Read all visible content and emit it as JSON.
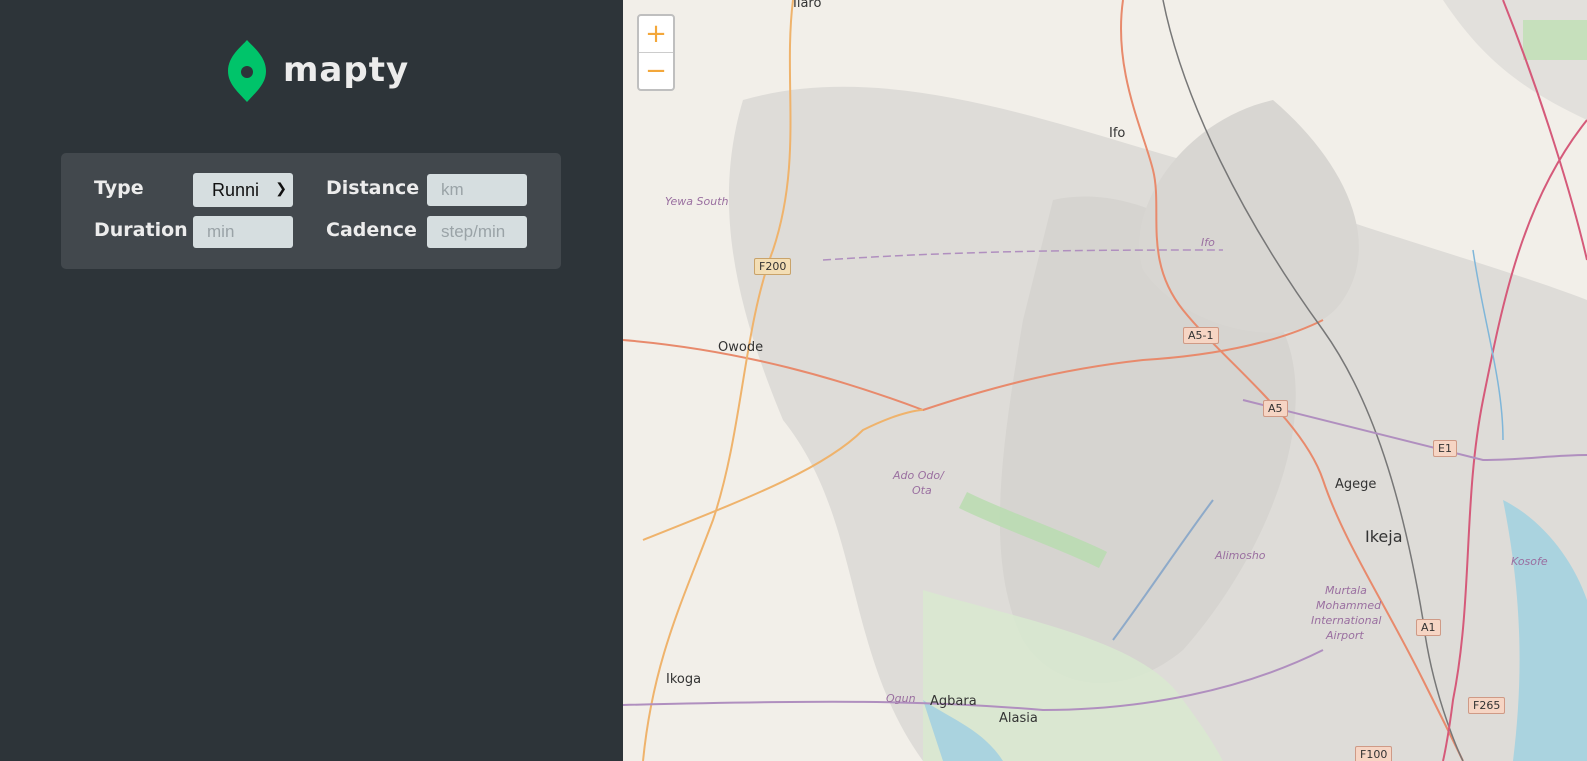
{
  "app": {
    "name": "mapty",
    "logo_icon": "map-pin-icon",
    "brand_color": "#00c46a"
  },
  "form": {
    "type_label": "Type",
    "type_value": "Runni",
    "distance_label": "Distance",
    "distance_placeholder": "km",
    "duration_label": "Duration",
    "duration_placeholder": "min",
    "cadence_label": "Cadence",
    "cadence_placeholder": "step/min"
  },
  "map": {
    "zoom_in": "+",
    "zoom_out": "−",
    "places": {
      "ilaro": "Ilaro",
      "ifo": "Ifo",
      "yewa_south": "Yewa South",
      "ifo2": "Ifo",
      "owode": "Owode",
      "ado_odo": "Ado Odo/",
      "ota": "Ota",
      "agege": "Agege",
      "ikeja": "Ikeja",
      "alimosho": "Alimosho",
      "kosofe": "Kosofe",
      "airport1": "Murtala",
      "airport2": "Mohammed",
      "airport3": "International",
      "airport4": "Airport",
      "ikoga": "Ikoga",
      "ogun": "Ogun",
      "agbara": "Agbara",
      "alasia": "Alasia"
    },
    "shields": {
      "f200": "F200",
      "a51": "A5-1",
      "a5": "A5",
      "e1": "E1",
      "a1": "A1",
      "f265": "F265",
      "f100": "F100"
    }
  }
}
